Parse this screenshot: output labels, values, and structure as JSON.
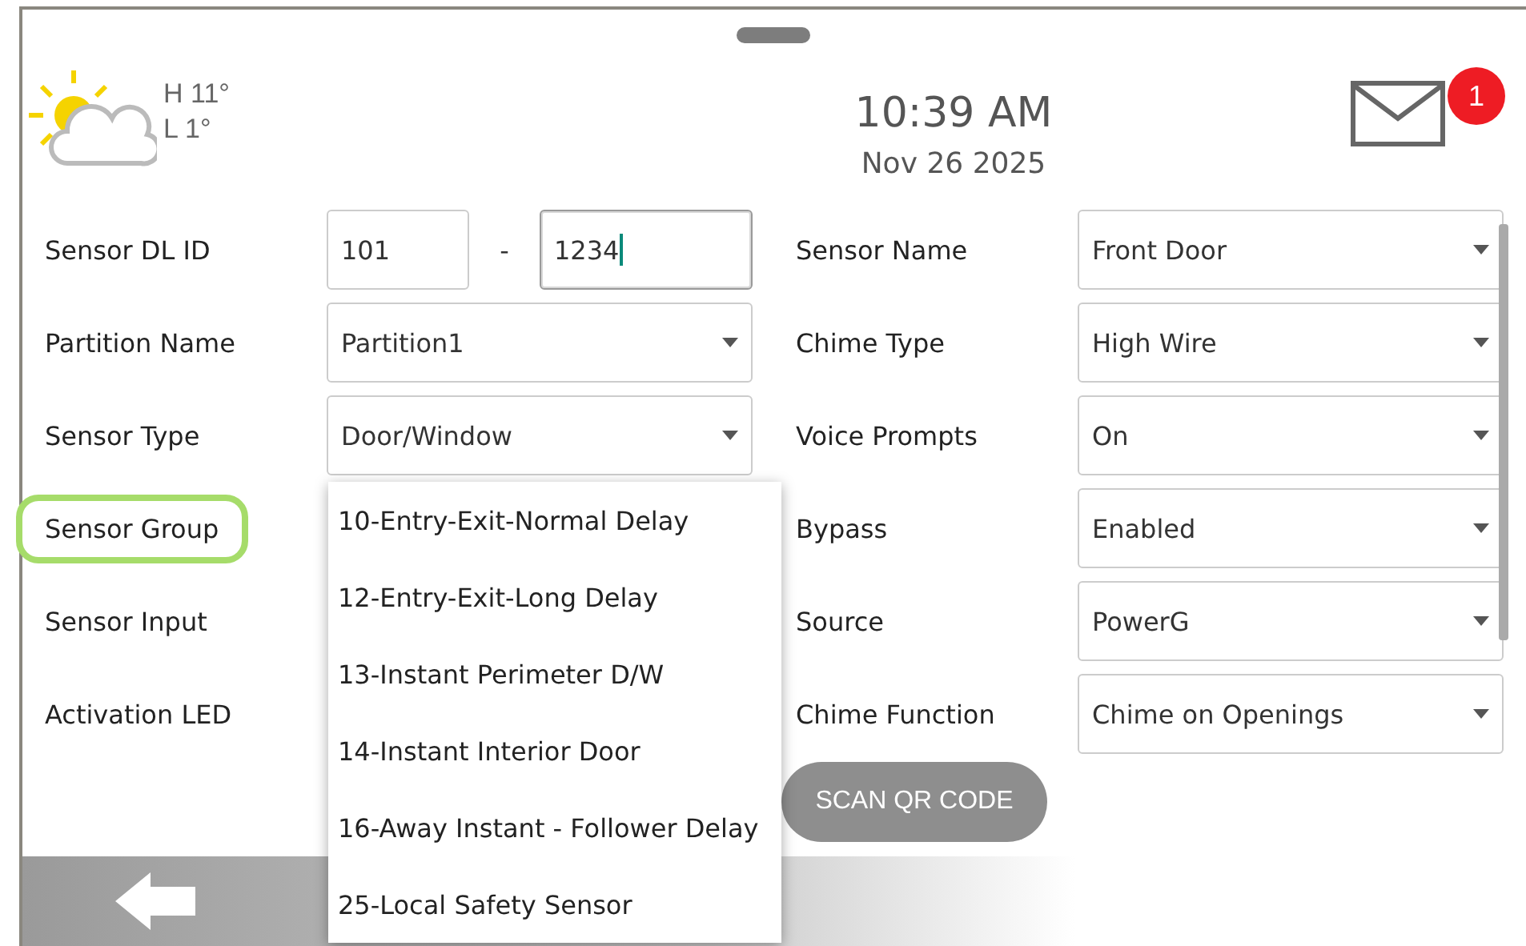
{
  "header": {
    "weather": {
      "high": "H 11°",
      "low": "L 1°"
    },
    "time": "10:39 AM",
    "date": "Nov 26 2025",
    "messages": {
      "badge": "1"
    }
  },
  "form": {
    "left": [
      {
        "label": "Sensor DL ID",
        "highlighted": false,
        "kind": "split",
        "separator": "-",
        "parts": [
          {
            "value": "101",
            "focused": false
          },
          {
            "value": "1234",
            "focused": true
          }
        ]
      },
      {
        "label": "Partition Name",
        "highlighted": false,
        "kind": "select",
        "value": "Partition1"
      },
      {
        "label": "Sensor Type",
        "highlighted": false,
        "kind": "select",
        "value": "Door/Window",
        "open": true,
        "options": [
          "10-Entry-Exit-Normal Delay",
          "12-Entry-Exit-Long Delay",
          "13-Instant Perimeter D/W",
          "14-Instant Interior Door",
          "16-Away Instant - Follower Delay",
          "25-Local Safety Sensor"
        ]
      },
      {
        "label": "Sensor Group",
        "highlighted": true,
        "kind": "covered"
      },
      {
        "label": "Sensor Input",
        "highlighted": false,
        "kind": "covered"
      },
      {
        "label": "Activation LED",
        "highlighted": false,
        "kind": "covered"
      }
    ],
    "right": [
      {
        "label": "Sensor Name",
        "highlighted": false,
        "kind": "select",
        "value": "Front Door"
      },
      {
        "label": "Chime Type",
        "highlighted": false,
        "kind": "select",
        "value": "High Wire"
      },
      {
        "label": "Voice Prompts",
        "highlighted": false,
        "kind": "select",
        "value": "On"
      },
      {
        "label": "Bypass",
        "highlighted": false,
        "kind": "select",
        "value": "Enabled"
      },
      {
        "label": "Source",
        "highlighted": false,
        "kind": "select",
        "value": "PowerG"
      },
      {
        "label": "Chime Function",
        "highlighted": false,
        "kind": "select",
        "value": "Chime on Openings"
      }
    ]
  },
  "scan_button": "SCAN QR CODE"
}
